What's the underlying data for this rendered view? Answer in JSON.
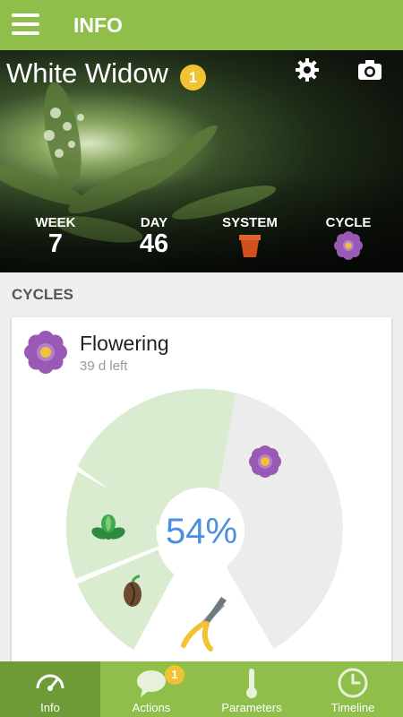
{
  "header": {
    "title": "INFO"
  },
  "plant": {
    "name": "White Widow",
    "notification_count": "1",
    "stats": {
      "week_label": "WEEK",
      "week_value": "7",
      "day_label": "DAY",
      "day_value": "46",
      "system_label": "SYSTEM",
      "system_icon": "pot-icon",
      "cycle_label": "CYCLE",
      "cycle_icon": "flower-icon"
    }
  },
  "cycles": {
    "section_title": "CYCLES",
    "current_name": "Flowering",
    "time_left": "39 d left",
    "progress_text": "54%",
    "progress": 0.54,
    "stage_icons": [
      "seed-icon",
      "sprout-icon",
      "flower-icon",
      "pruning-shears-icon"
    ]
  },
  "colors": {
    "accent": "#8fbf4a",
    "accent_dark": "#6f9a38",
    "badge": "#f1c232",
    "progress_text": "#4a8fe0",
    "completed_segment": "#d9ecd0",
    "remaining_segment": "#ececec"
  },
  "nav": {
    "items": [
      {
        "label": "Info",
        "icon": "speedometer-icon"
      },
      {
        "label": "Actions",
        "icon": "chat-bubble-icon",
        "badge": "1"
      },
      {
        "label": "Parameters",
        "icon": "thermometer-icon"
      },
      {
        "label": "Timeline",
        "icon": "clock-icon"
      }
    ]
  }
}
